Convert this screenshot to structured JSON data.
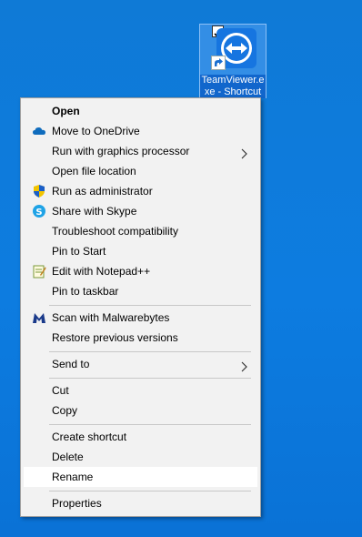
{
  "desktop": {
    "shortcut": {
      "label_line1": "TeamViewer.e",
      "label_line2": "xe - Shortcut",
      "checked": true
    }
  },
  "context_menu": {
    "items": [
      {
        "label": "Open",
        "icon": "none",
        "bold": true
      },
      {
        "label": "Move to OneDrive",
        "icon": "onedrive-cloud-icon"
      },
      {
        "label": "Run with graphics processor",
        "icon": "none",
        "submenu": true
      },
      {
        "label": "Open file location",
        "icon": "none"
      },
      {
        "label": "Run as administrator",
        "icon": "uac-shield-icon"
      },
      {
        "label": "Share with Skype",
        "icon": "skype-icon"
      },
      {
        "label": "Troubleshoot compatibility",
        "icon": "none"
      },
      {
        "label": "Pin to Start",
        "icon": "none"
      },
      {
        "label": "Edit with Notepad++",
        "icon": "notepadpp-icon"
      },
      {
        "label": "Pin to taskbar",
        "icon": "none"
      },
      {
        "label": "Scan with Malwarebytes",
        "icon": "malwarebytes-icon"
      },
      {
        "label": "Restore previous versions",
        "icon": "none"
      },
      {
        "label": "Send to",
        "icon": "none",
        "submenu": true
      },
      {
        "label": "Cut",
        "icon": "none"
      },
      {
        "label": "Copy",
        "icon": "none"
      },
      {
        "label": "Create shortcut",
        "icon": "none"
      },
      {
        "label": "Delete",
        "icon": "none"
      },
      {
        "label": "Rename",
        "icon": "none",
        "highlighted": true
      },
      {
        "label": "Properties",
        "icon": "none"
      }
    ]
  },
  "colors": {
    "desktop": "#0f7bd8",
    "menu_bg": "#f2f2f2",
    "highlight": "#ffffff",
    "onedrive": "#0f6cbd",
    "skype": "#1fa3e6",
    "malwarebytes": "#1a3a8a",
    "teamviewer": "#1675e0"
  }
}
